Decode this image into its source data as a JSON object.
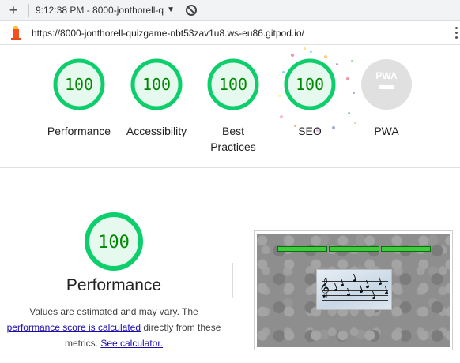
{
  "toolbar": {
    "new_tab": "+",
    "tab_title": "9:12:38 PM - 8000-jonthorell-q",
    "caret": "▼"
  },
  "address": {
    "url": "https://8000-jonthorell-quizgame-nbt53zav1u8.ws-eu86.gitpod.io/"
  },
  "gauges": [
    {
      "score": "100",
      "label": "Performance"
    },
    {
      "score": "100",
      "label": "Accessibility"
    },
    {
      "score": "100",
      "label_line1": "Best",
      "label_line2": "Practices"
    },
    {
      "score": "100",
      "label": "SEO"
    },
    {
      "badge": "PWA",
      "label": "PWA"
    }
  ],
  "performance": {
    "score": "100",
    "title": "Performance",
    "desc_part1": "Values are estimated and may vary. The",
    "link1": "performance score is calculated",
    "desc_part2": " directly from these",
    "desc_part3": "metrics. ",
    "link2": "See calculator."
  },
  "colors": {
    "pass_green": "#0cce6b",
    "pass_fill": "#e6f9ee",
    "pass_text": "#008800",
    "pwa_gray": "#e0e0e0"
  }
}
